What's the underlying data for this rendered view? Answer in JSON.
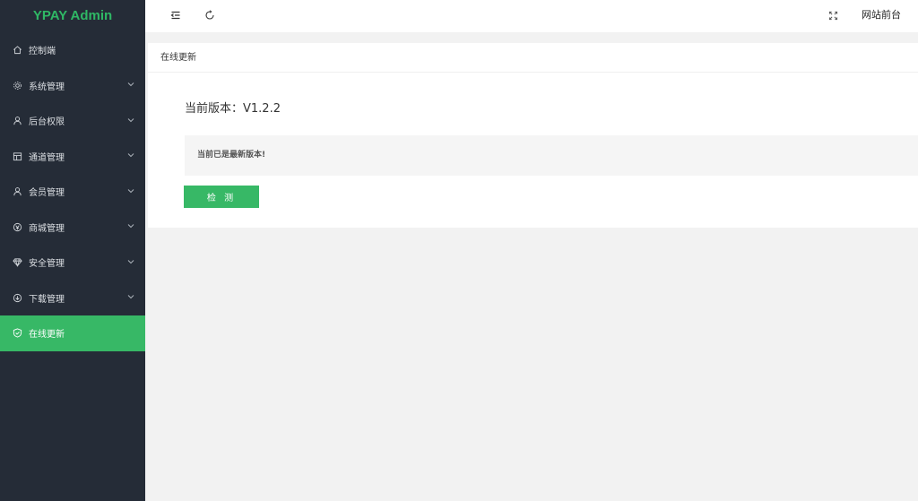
{
  "app": {
    "title": "YPAY Admin"
  },
  "sidebar": {
    "items": [
      {
        "label": "控制端",
        "icon": "home-icon",
        "has_arrow": false,
        "active": false
      },
      {
        "label": "系统管理",
        "icon": "gear-icon",
        "has_arrow": true,
        "active": false
      },
      {
        "label": "后台权限",
        "icon": "user-icon",
        "has_arrow": true,
        "active": false
      },
      {
        "label": "通道管理",
        "icon": "channel-icon",
        "has_arrow": true,
        "active": false
      },
      {
        "label": "会员管理",
        "icon": "user-icon",
        "has_arrow": true,
        "active": false
      },
      {
        "label": "商城管理",
        "icon": "shop-icon",
        "has_arrow": true,
        "active": false
      },
      {
        "label": "安全管理",
        "icon": "diamond-icon",
        "has_arrow": true,
        "active": false
      },
      {
        "label": "下载管理",
        "icon": "download-icon",
        "has_arrow": true,
        "active": false
      },
      {
        "label": "在线更新",
        "icon": "shield-check-icon",
        "has_arrow": false,
        "active": true
      }
    ]
  },
  "header": {
    "menu_toggle_icon": "menu-fold-icon",
    "refresh_icon": "refresh-icon",
    "fullscreen_icon": "fullscreen-icon",
    "site_link": "网站前台"
  },
  "main": {
    "card_title": "在线更新",
    "version_label": "当前版本：",
    "version_value": "V1.2.2",
    "notice": "当前已是最新版本!",
    "check_button": "检 测"
  },
  "colors": {
    "sidebar_bg": "#252c37",
    "accent": "#37b866",
    "logo": "#2fb865",
    "page_bg": "#f2f2f2"
  }
}
